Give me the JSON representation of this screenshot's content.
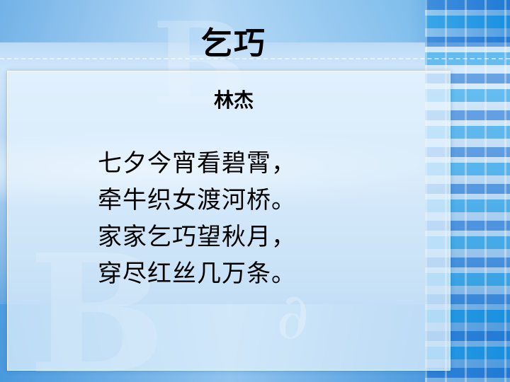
{
  "slide": {
    "title": "乞巧",
    "author": "林杰",
    "poem_lines": [
      "七夕今宵看碧霄，",
      "牵牛织女渡河桥。",
      "家家乞巧望秋月，",
      "穿尽红丝几万条。"
    ]
  }
}
